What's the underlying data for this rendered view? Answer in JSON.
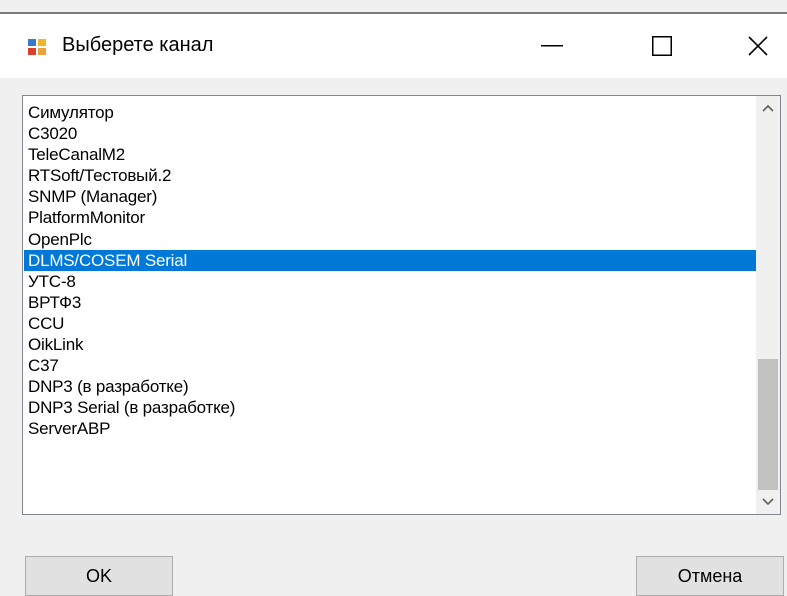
{
  "window": {
    "title": "Выберете канал",
    "icon": "window-app-icon",
    "controls": {
      "minimize_icon": "minimize-icon",
      "maximize_icon": "maximize-icon",
      "close_icon": "close-icon"
    }
  },
  "list": {
    "items": [
      "Симулятор",
      "C3020",
      "TeleCanalM2",
      "RTSoft/Тестовый.2",
      "SNMP (Manager)",
      "PlatformMonitor",
      "OpenPlc",
      "DLMS/COSEM Serial",
      "УТС-8",
      "ВРТФ3",
      "CCU",
      "OikLink",
      "C37",
      "DNP3 (в разработке)",
      "DNP3 Serial (в разработке)",
      "ServerABP"
    ],
    "selected_index": 7,
    "selected_color": "#0078d7"
  },
  "buttons": {
    "ok_label": "OK",
    "cancel_label": "Отмена"
  }
}
